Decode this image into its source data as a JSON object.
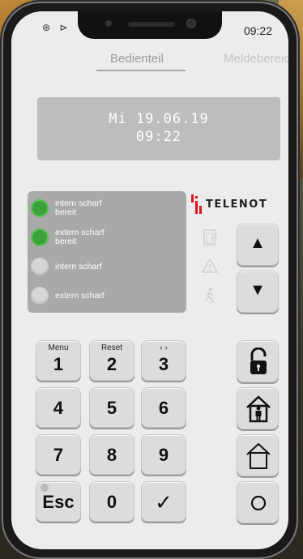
{
  "status_bar": {
    "icons": "⊛ ⊳",
    "time": "09:22"
  },
  "tabs": [
    {
      "label": "Bedienteil"
    },
    {
      "label": "Meldebereich"
    }
  ],
  "display": {
    "line1": "Mi 19.06.19",
    "line2": "09:22"
  },
  "leds": [
    {
      "line1": "intern scharf",
      "line2": "bereit",
      "on": true
    },
    {
      "line1": "extern scharf",
      "line2": "bereit",
      "on": true
    },
    {
      "line1": "intern scharf",
      "line2": "",
      "on": false
    },
    {
      "line1": "extern scharf",
      "line2": "",
      "on": false
    }
  ],
  "logo": {
    "text": "TELENOT",
    "color": "#e0141e"
  },
  "indicator_icons": [
    "door-icon",
    "warning-triangle-icon",
    "walking-person-icon"
  ],
  "arrows": {
    "up": "▲",
    "down": "▼"
  },
  "keypad": {
    "k1": {
      "sub": "Menu",
      "main": "1"
    },
    "k2": {
      "sub": "Reset",
      "main": "2"
    },
    "k3": {
      "sub": "‹ ›",
      "main": "3"
    },
    "k4": {
      "main": "4"
    },
    "k5": {
      "main": "5"
    },
    "k6": {
      "main": "6"
    },
    "k7": {
      "main": "7"
    },
    "k8": {
      "main": "8"
    },
    "k9": {
      "main": "9"
    },
    "esc": {
      "main": "Esc"
    },
    "k0": {
      "main": "0"
    },
    "ok": {
      "main": "✓"
    }
  },
  "side_keys": [
    "unlock-icon",
    "person-in-house-icon",
    "house-icon",
    "circle-icon"
  ],
  "colors": {
    "led_on": "#3ea23b",
    "panel": "#a9a9a9",
    "display_bg": "#bdbdbd"
  }
}
